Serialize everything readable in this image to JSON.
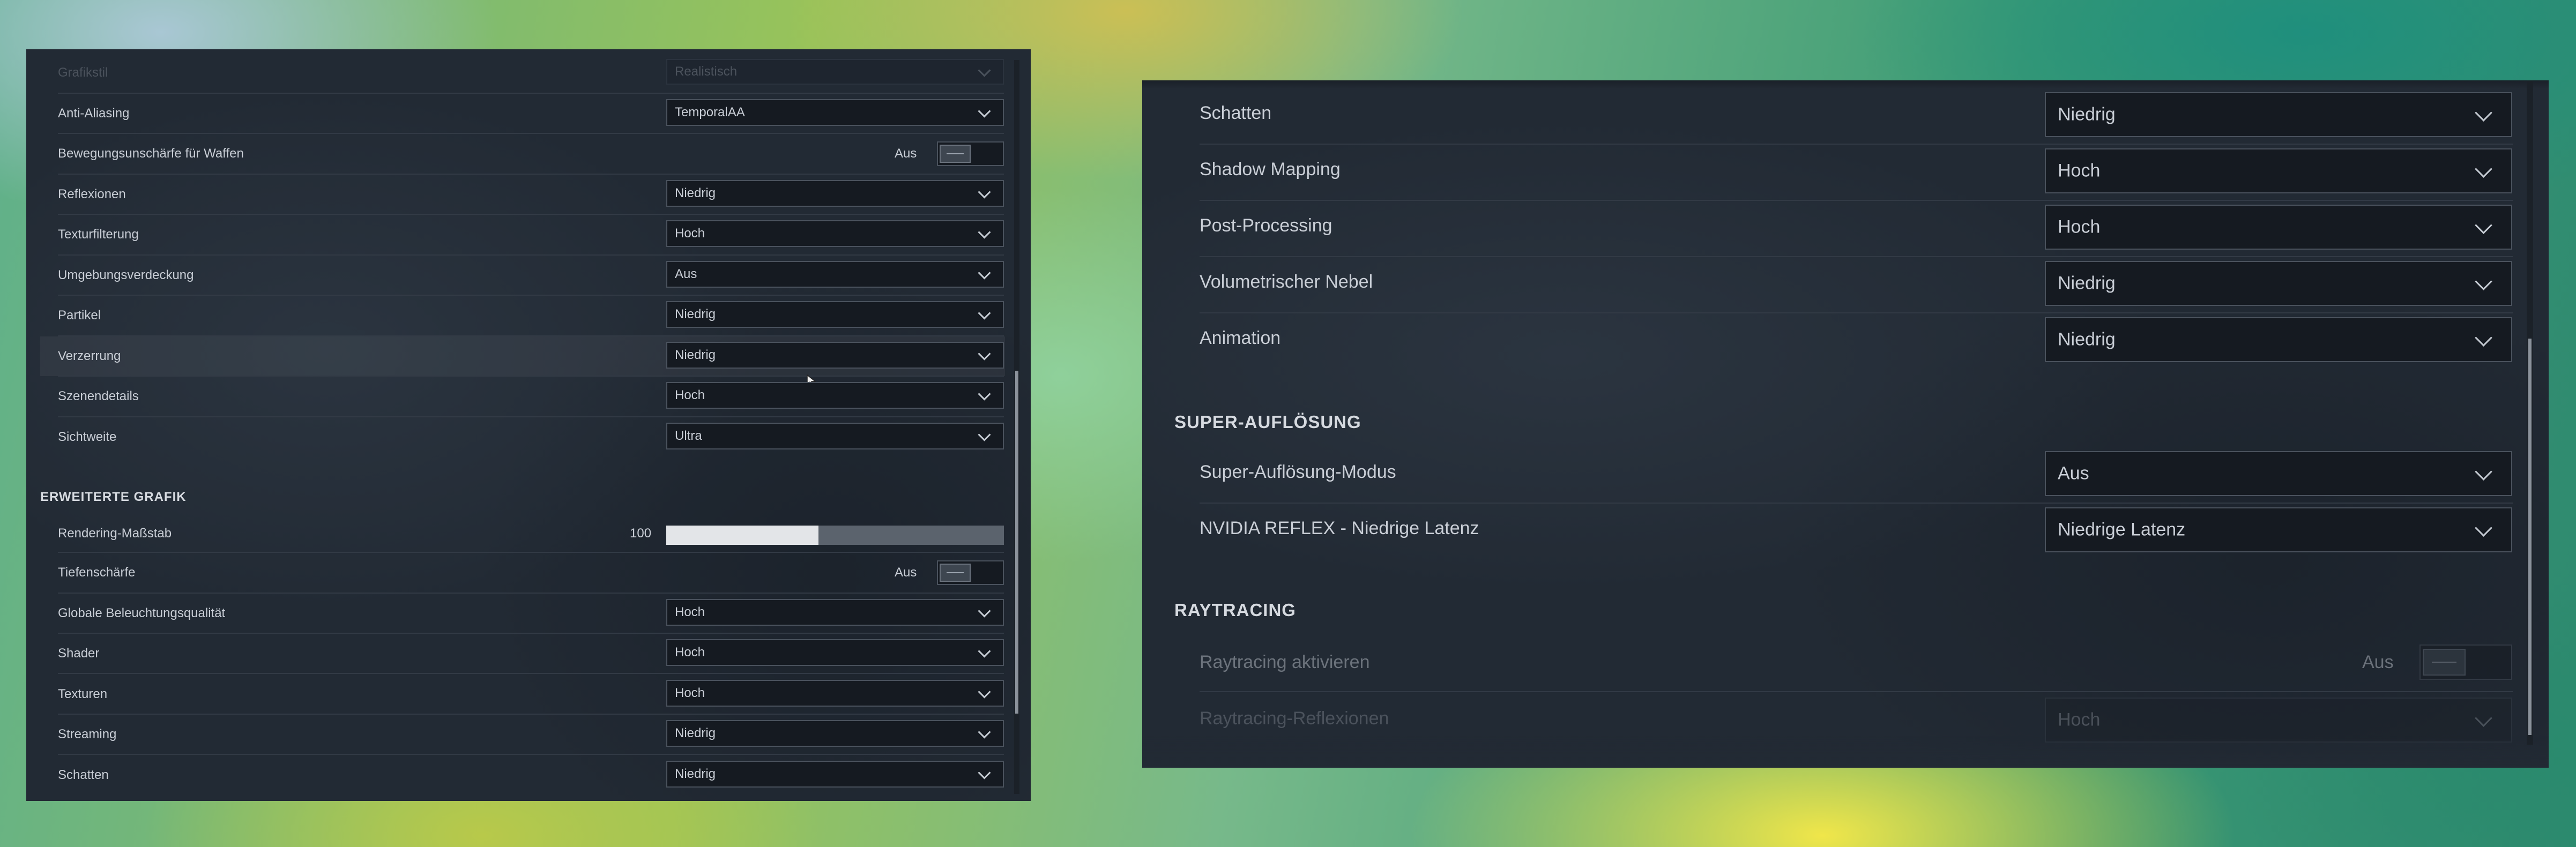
{
  "left_panel": {
    "rows": [
      {
        "label": "Grafikstil",
        "value": "Realistisch",
        "type": "dropdown",
        "state": "faded"
      },
      {
        "label": "Anti-Aliasing",
        "value": "TemporalAA",
        "type": "dropdown"
      },
      {
        "label": "Bewegungsunschärfe für Waffen",
        "value": "Aus",
        "type": "toggle"
      },
      {
        "label": "Reflexionen",
        "value": "Niedrig",
        "type": "dropdown"
      },
      {
        "label": "Texturfilterung",
        "value": "Hoch",
        "type": "dropdown"
      },
      {
        "label": "Umgebungsverdeckung",
        "value": "Aus",
        "type": "dropdown"
      },
      {
        "label": "Partikel",
        "value": "Niedrig",
        "type": "dropdown"
      },
      {
        "label": "Verzerrung",
        "value": "Niedrig",
        "type": "dropdown",
        "state": "hovered"
      },
      {
        "label": "Szenendetails",
        "value": "Hoch",
        "type": "dropdown"
      },
      {
        "label": "Sichtweite",
        "value": "Ultra",
        "type": "dropdown"
      }
    ],
    "section_title": "ERWEITERTE GRAFIK",
    "slider": {
      "label": "Rendering-Maßstab",
      "value_text": "100",
      "fill_fraction": 0.45
    },
    "rows2": [
      {
        "label": "Tiefenschärfe",
        "value": "Aus",
        "type": "toggle"
      },
      {
        "label": "Globale Beleuchtungsqualität",
        "value": "Hoch",
        "type": "dropdown"
      },
      {
        "label": "Shader",
        "value": "Hoch",
        "type": "dropdown"
      },
      {
        "label": "Texturen",
        "value": "Hoch",
        "type": "dropdown"
      },
      {
        "label": "Streaming",
        "value": "Niedrig",
        "type": "dropdown"
      },
      {
        "label": "Schatten",
        "value": "Niedrig",
        "type": "dropdown"
      }
    ]
  },
  "right_panel": {
    "rows": [
      {
        "label": "Schatten",
        "value": "Niedrig"
      },
      {
        "label": "Shadow Mapping",
        "value": "Hoch"
      },
      {
        "label": "Post-Processing",
        "value": "Hoch"
      },
      {
        "label": "Volumetrischer Nebel",
        "value": "Niedrig"
      },
      {
        "label": "Animation",
        "value": "Niedrig"
      }
    ],
    "section_super": "SUPER-AUFLÖSUNG",
    "rows_super": [
      {
        "label": "Super-Auflösung-Modus",
        "value": "Aus"
      },
      {
        "label": "NVIDIA REFLEX - Niedrige Latenz",
        "value": "Niedrige Latenz"
      }
    ],
    "section_rt": "RAYTRACING",
    "rt_toggle": {
      "label": "Raytracing aktivieren",
      "value": "Aus"
    },
    "rt_reflex": {
      "label": "Raytracing-Reflexionen",
      "value": "Hoch"
    }
  },
  "colors": {
    "panel_bg": "#222a34",
    "text": "#c9ced6",
    "border": "#4a525d",
    "slider_fill": "#e3e5e8",
    "slider_track": "#5b636d"
  },
  "icons": {
    "dropdown": "chevron-down-icon",
    "cursor": "mouse-cursor-icon"
  }
}
